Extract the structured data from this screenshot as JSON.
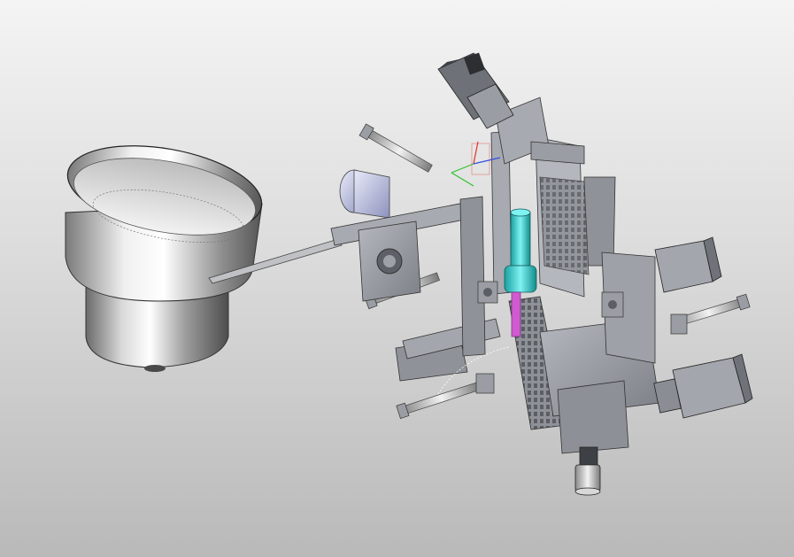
{
  "viewport": {
    "background_top": "#f4f4f4",
    "background_bottom": "#b9b9b9"
  },
  "model": {
    "bowl_metal_light": "#f5f5f5",
    "bowl_metal_dark": "#5e5e5e",
    "frame_gray": "#9a9da3",
    "frame_dark": "#5b5e63",
    "motor_blue": "#c7cbe6",
    "cylinder_cyan": "#3fd4d4",
    "rod_magenta": "#d05ad0",
    "triad_x": "#e03030",
    "triad_y": "#30c030",
    "triad_z": "#3050e0"
  }
}
